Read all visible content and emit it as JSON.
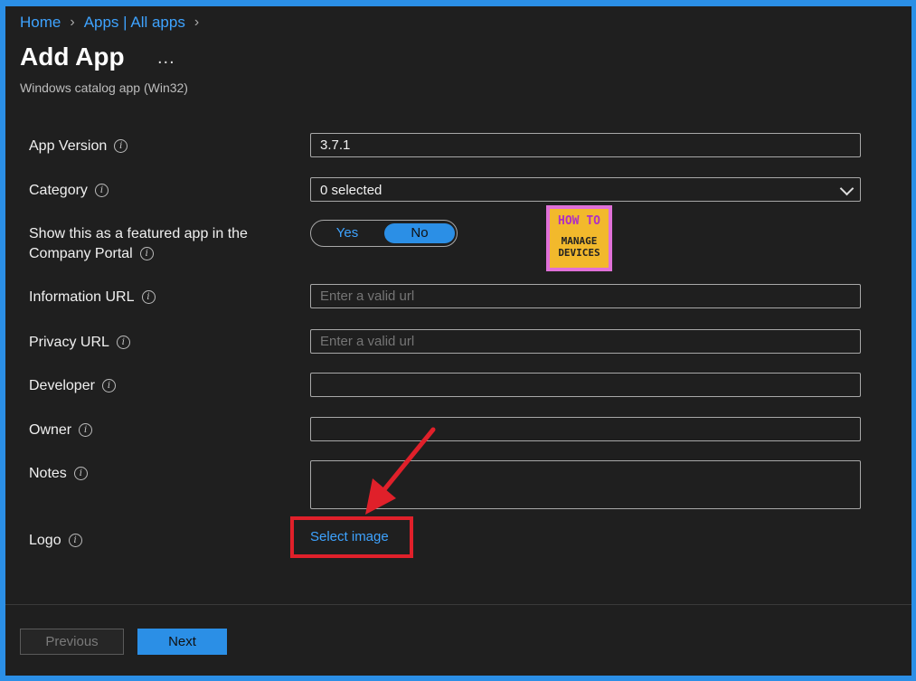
{
  "breadcrumb": {
    "home": "Home",
    "apps": "Apps | All apps"
  },
  "header": {
    "title": "Add App",
    "more": "...",
    "subtitle": "Windows catalog app (Win32)"
  },
  "form": {
    "app_version": {
      "label": "App Version",
      "value": "3.7.1"
    },
    "category": {
      "label": "Category",
      "value": "0 selected"
    },
    "featured": {
      "label_line1": "Show this as a featured app in the",
      "label_line2": "Company Portal",
      "yes": "Yes",
      "no": "No",
      "selected": "No"
    },
    "info_url": {
      "label": "Information URL",
      "placeholder": "Enter a valid url"
    },
    "privacy_url": {
      "label": "Privacy URL",
      "placeholder": "Enter a valid url"
    },
    "developer": {
      "label": "Developer",
      "value": ""
    },
    "owner": {
      "label": "Owner",
      "value": ""
    },
    "notes": {
      "label": "Notes",
      "value": ""
    },
    "logo": {
      "label": "Logo",
      "link": "Select image"
    }
  },
  "watermark": {
    "top": "HOW TO",
    "bottom_line1": "MANAGE",
    "bottom_line2": "DEVICES"
  },
  "footer": {
    "previous": "Previous",
    "next": "Next"
  },
  "colors": {
    "accent": "#2b8fe6",
    "highlight": "#e0202a",
    "link": "#3ea3ff"
  }
}
